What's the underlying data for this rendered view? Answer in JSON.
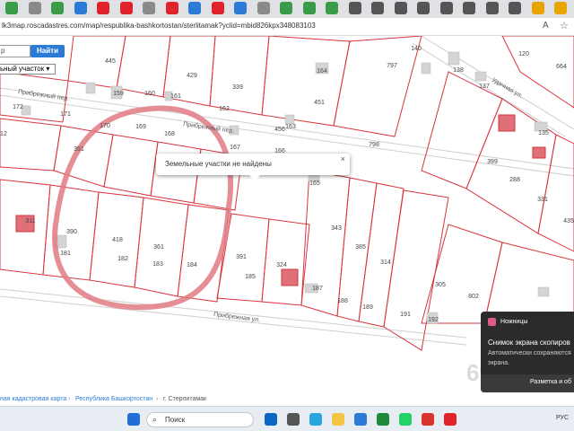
{
  "browser": {
    "url": "lk3map.roscadastres.com/map/respublika-bashkortostan/sterlitamak?yclid=mbid826kpx348083103",
    "tab_colors": [
      "#3a9b48",
      "#8a8a8a",
      "#3a9b48",
      "#2b7bd6",
      "#e0222a",
      "#e0222a",
      "#8a8a8a",
      "#e0222a",
      "#2b7bd6",
      "#e0222a",
      "#2b7bd6",
      "#8a8a8a",
      "#3a9b48",
      "#3a9b48",
      "#3a9b48",
      "#555555",
      "#555555",
      "#555555",
      "#555555",
      "#555555",
      "#555555",
      "#555555",
      "#555555",
      "#e8a400",
      "#e8a400"
    ],
    "reader_icon": "A",
    "star_icon": "☆"
  },
  "map": {
    "search_placeholder": "р",
    "find_button": "Найти",
    "type_select": "ьный участок",
    "popup_text": "Земельные участки не найдены",
    "popup_close": "×",
    "watermark": "69",
    "streets": {
      "pribrezhny_per_1": "Прибрежный пер.",
      "pribrezhny_per_2": "Прибрежный пер.",
      "pribrezhnaya_ul": "Прибрежная ул.",
      "udachnaya_ul": "Удачная ул."
    },
    "parcels": [
      {
        "label": "445"
      },
      {
        "label": "429"
      },
      {
        "label": "339"
      },
      {
        "label": "451"
      },
      {
        "label": "797"
      },
      {
        "label": "140"
      },
      {
        "label": "138"
      },
      {
        "label": "137"
      },
      {
        "label": "120"
      },
      {
        "label": "664"
      },
      {
        "label": "164"
      },
      {
        "label": "163"
      },
      {
        "label": "159"
      },
      {
        "label": "160"
      },
      {
        "label": "161"
      },
      {
        "label": "162"
      },
      {
        "label": "172"
      },
      {
        "label": "171"
      },
      {
        "label": "170"
      },
      {
        "label": "169"
      },
      {
        "label": "168"
      },
      {
        "label": "167"
      },
      {
        "label": "166"
      },
      {
        "label": "165"
      },
      {
        "label": "182"
      },
      {
        "label": "183"
      },
      {
        "label": "184"
      },
      {
        "label": "185"
      },
      {
        "label": "187"
      },
      {
        "label": "188"
      },
      {
        "label": "189"
      },
      {
        "label": "191"
      },
      {
        "label": "192"
      },
      {
        "label": "181"
      },
      {
        "label": "390"
      },
      {
        "label": "418"
      },
      {
        "label": "361"
      },
      {
        "label": "391"
      },
      {
        "label": "324"
      },
      {
        "label": "343"
      },
      {
        "label": "385"
      },
      {
        "label": "314"
      },
      {
        "label": "305"
      },
      {
        "label": "802"
      },
      {
        "label": "798"
      },
      {
        "label": "399"
      },
      {
        "label": "288"
      },
      {
        "label": "331"
      },
      {
        "label": "435"
      },
      {
        "label": "135"
      },
      {
        "label": "311"
      },
      {
        "label": "312"
      },
      {
        "label": "351"
      },
      {
        "label": "456"
      }
    ]
  },
  "breadcrumbs": [
    "ная кадастровая карта",
    "Республика Башкортостан",
    "г. Стерлитамак"
  ],
  "breadcrumb_separator": "›",
  "taskbar": {
    "search_label": "Поиск",
    "search_icon": "⌕",
    "lang": "РУС",
    "app_colors": [
      "#0a66c2",
      "#555555",
      "#2aa5e0",
      "#f4c542",
      "#2b7bd6",
      "#1c8a3a",
      "#25d366",
      "#d9342b",
      "#e0222a",
      "#e0222a"
    ]
  },
  "notification": {
    "app": "Ножницы",
    "title": "Снимок экрана скопиров",
    "body": "Автоматически сохраняются экрана.",
    "action": "Разметка и об"
  }
}
